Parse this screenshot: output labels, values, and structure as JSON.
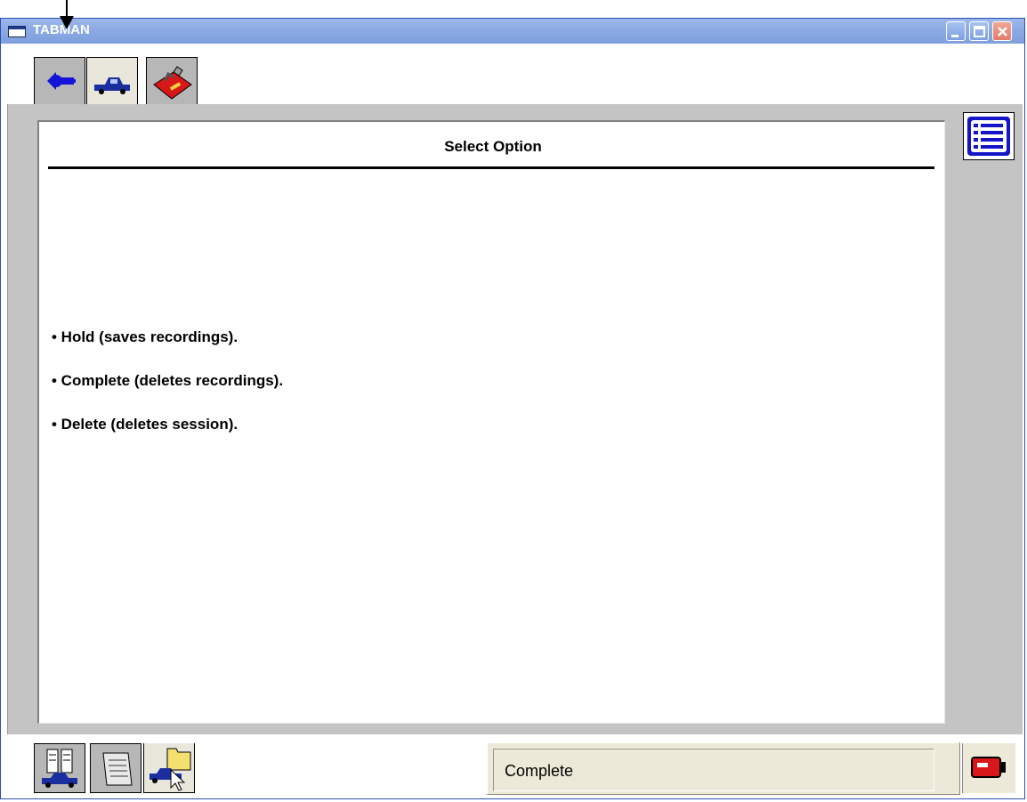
{
  "window": {
    "title": "TABMAN"
  },
  "top_tabs": [
    {
      "icon": "connect-icon",
      "active": false
    },
    {
      "icon": "vehicle-icon",
      "active": true
    },
    {
      "icon": "toolbox-icon",
      "active": false
    }
  ],
  "main": {
    "heading": "Select Option",
    "options": [
      "• Hold (saves recordings).",
      "• Complete (deletes recordings).",
      "• Delete (deletes session)."
    ]
  },
  "bottom_tabs": [
    {
      "icon": "vehicle-data-icon",
      "active": false
    },
    {
      "icon": "script-icon",
      "active": false
    },
    {
      "icon": "session-folder-icon",
      "active": true
    }
  ],
  "status": {
    "text": "Complete",
    "battery_icon": "battery-icon"
  },
  "colors": {
    "titlebar": "#8aa9e3",
    "panel": "#c4c4c4",
    "status_bg": "#ece9d8"
  }
}
